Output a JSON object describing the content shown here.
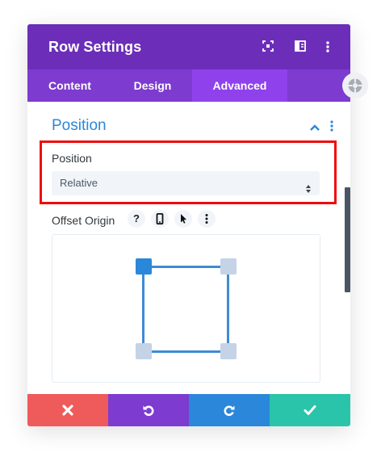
{
  "header": {
    "title": "Row Settings",
    "icons": [
      "expand-icon",
      "sidebar-split-icon",
      "kebab-menu-icon"
    ]
  },
  "tabs": [
    {
      "label": "Content",
      "active": false
    },
    {
      "label": "Design",
      "active": false
    },
    {
      "label": "Advanced",
      "active": true
    }
  ],
  "section": {
    "title": "Position",
    "collapsed": false
  },
  "position_field": {
    "label": "Position",
    "value": "Relative"
  },
  "offset_origin": {
    "label": "Offset Origin",
    "help_icon_text": "?",
    "selected_corner": "top-left"
  },
  "footer": {
    "buttons": [
      "cancel",
      "undo",
      "redo",
      "save"
    ]
  },
  "colors": {
    "header": "#6c2eb9",
    "tabs": "#7d3bcf",
    "active_tab": "#8f42ec",
    "accent_blue": "#2b87da",
    "highlight_red": "#ee0c0c",
    "cancel": "#ef5a5b",
    "undo": "#7d3bcf",
    "redo": "#2b87da",
    "save": "#29c4a9"
  }
}
